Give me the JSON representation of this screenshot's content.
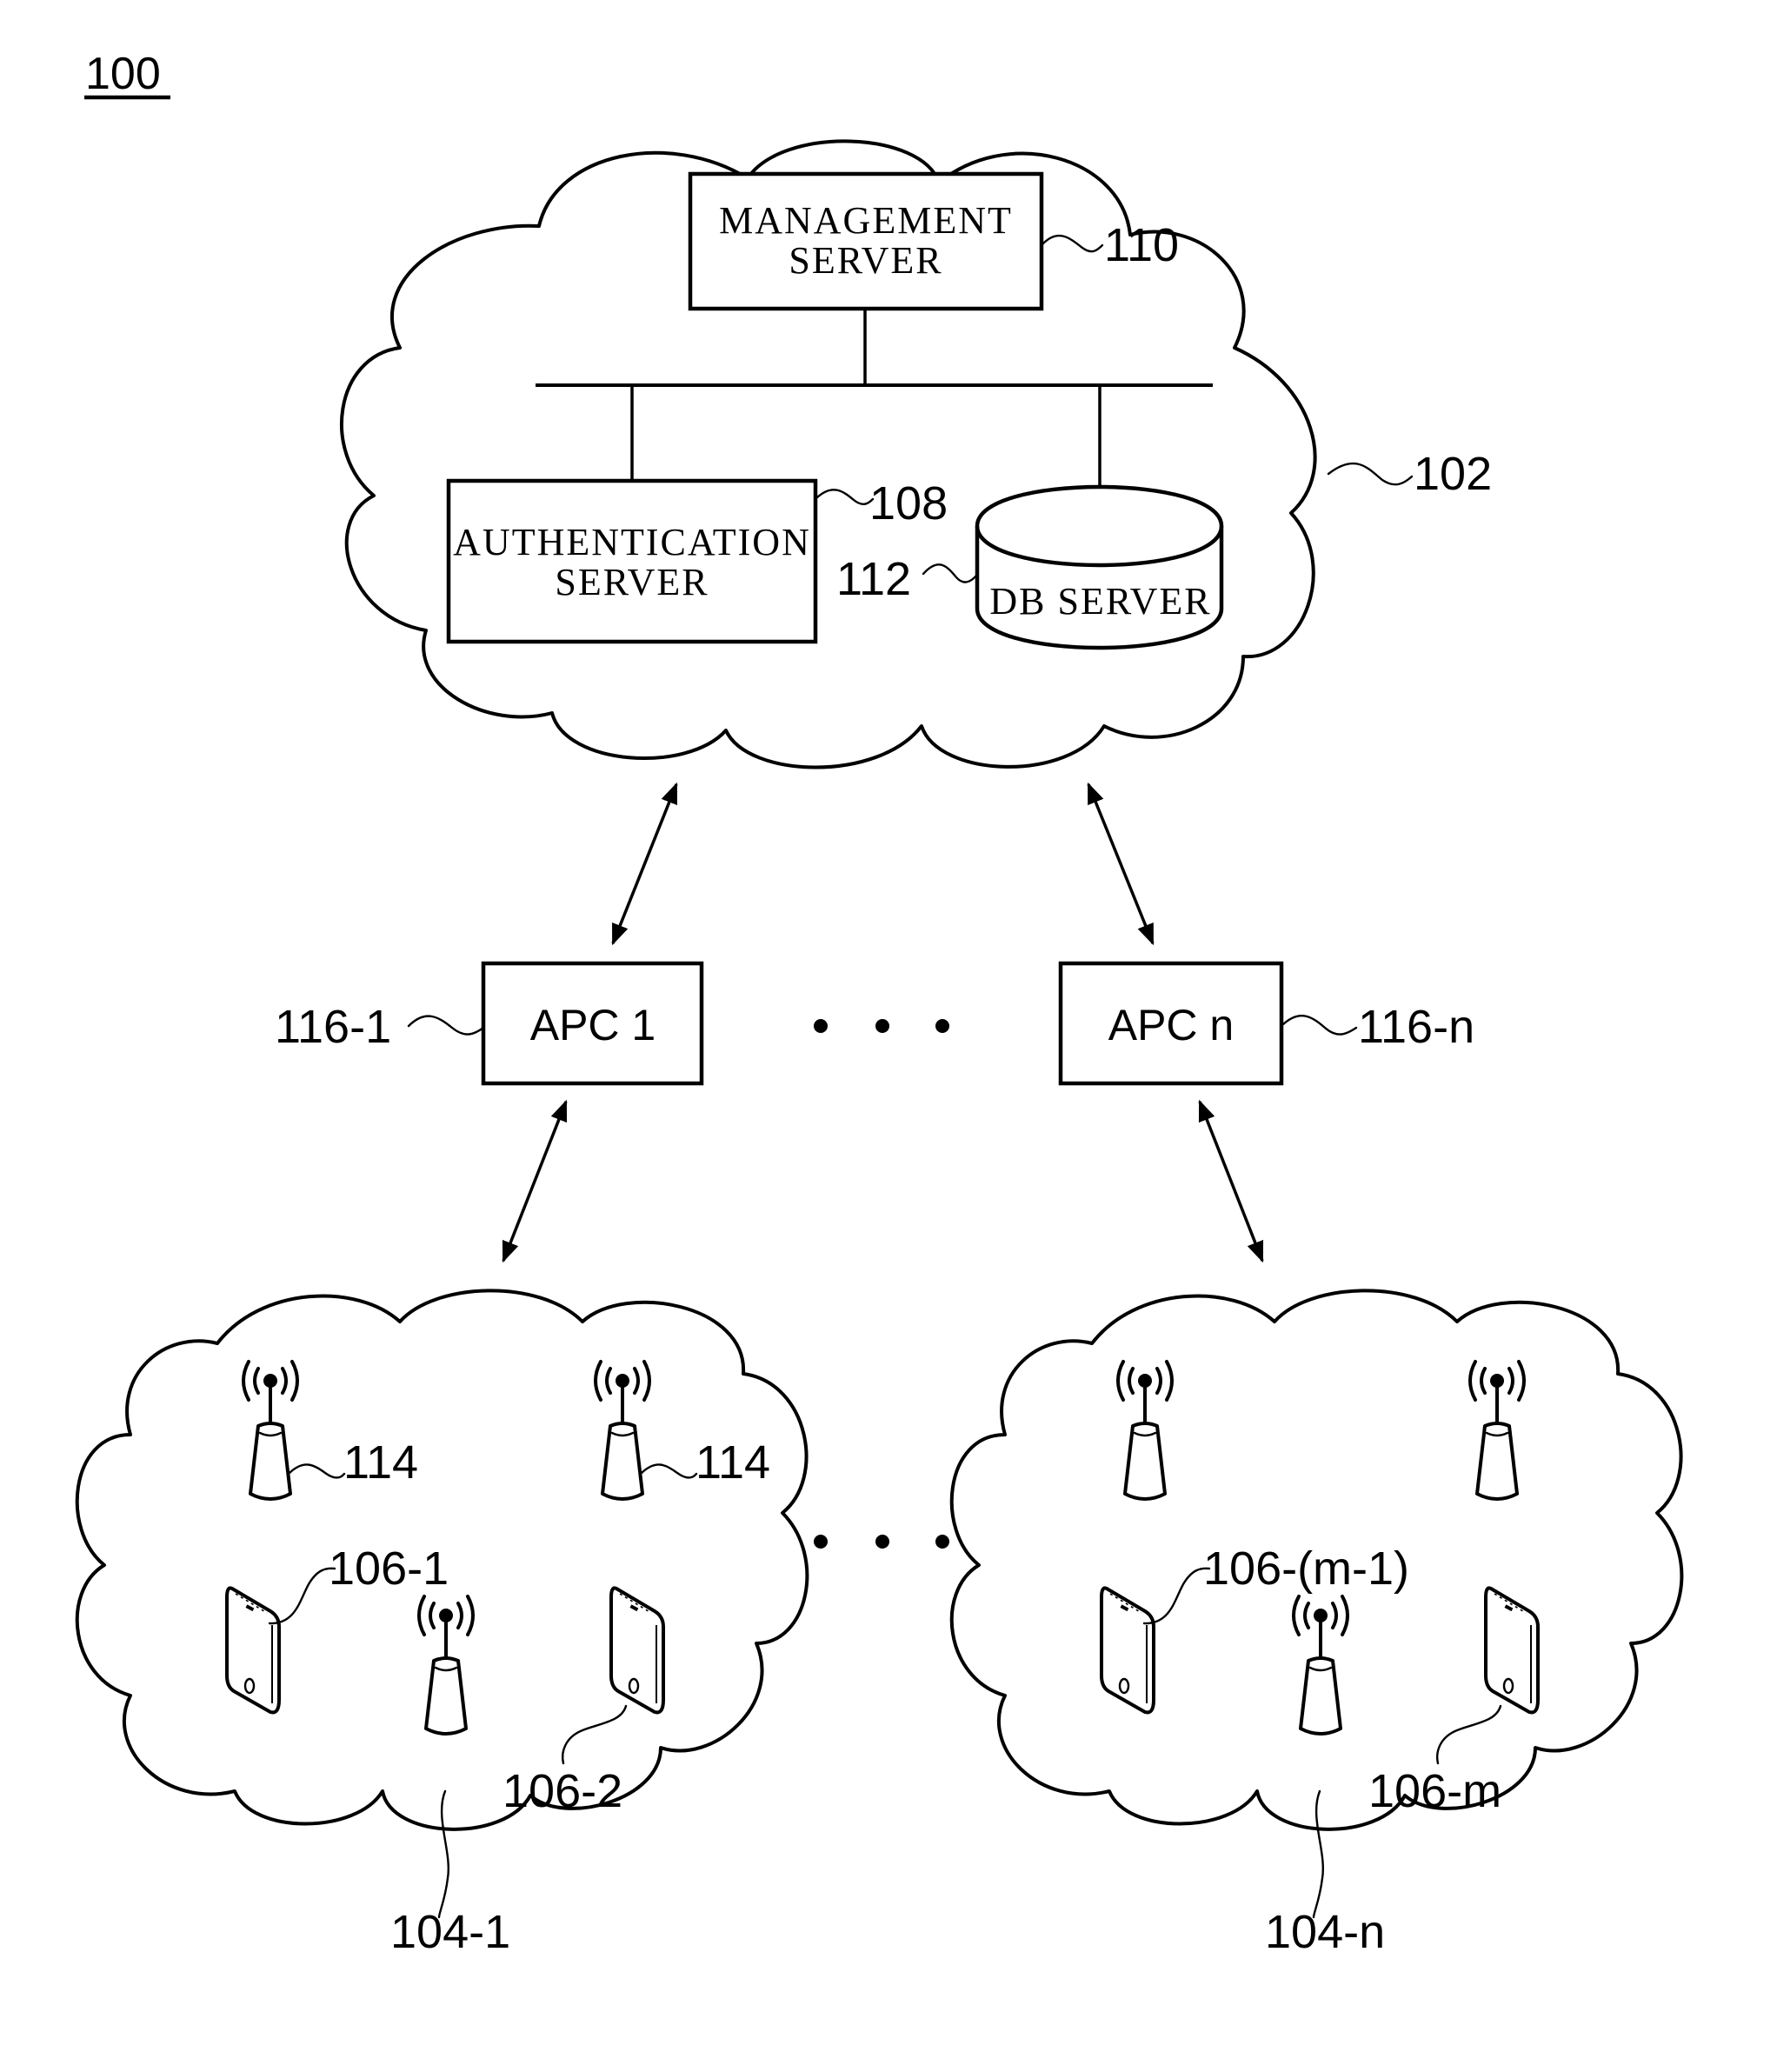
{
  "figure": {
    "label": "100",
    "colors": {
      "ink": "#000000",
      "background": "#ffffff"
    }
  },
  "core_network": {
    "ref": "102",
    "management_server": {
      "line1": "MANAGEMENT",
      "line2": "SERVER",
      "ref": "110"
    },
    "authentication_server": {
      "line1": "AUTHENTICATION",
      "line2": "SERVER",
      "ref": "108"
    },
    "db_server": {
      "label": "DB SERVER",
      "ref": "112"
    }
  },
  "apcs": [
    {
      "label": "APC 1",
      "ref": "116-1"
    },
    {
      "label": "APC n",
      "ref": "116-n"
    }
  ],
  "ellipsis": "• • •",
  "access_networks": [
    {
      "ref": "104-1",
      "ap_ref": "114",
      "ap_ref_2": "114",
      "devices": [
        {
          "ref": "106-1"
        },
        {
          "ref": "106-2"
        }
      ]
    },
    {
      "ref": "104-n",
      "devices": [
        {
          "ref": "106-(m-1)"
        },
        {
          "ref": "106-m"
        }
      ]
    }
  ],
  "icons": [
    "cloud-icon",
    "database-cylinder-icon",
    "access-point-antenna-icon",
    "smartphone-icon",
    "bidirectional-arrow-icon"
  ]
}
